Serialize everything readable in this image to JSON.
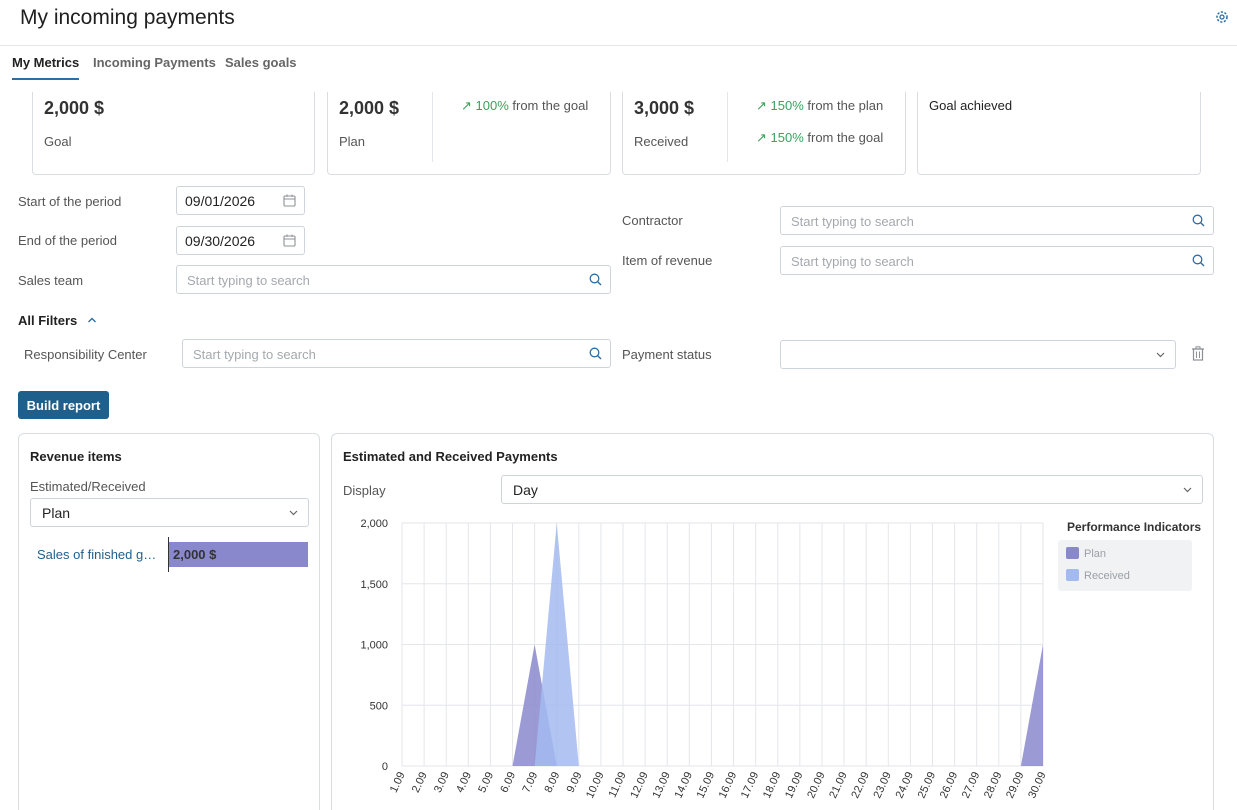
{
  "header": {
    "title": "My incoming payments"
  },
  "tabs": [
    {
      "label": "My Metrics",
      "active": true
    },
    {
      "label": "Incoming Payments",
      "active": false
    },
    {
      "label": "Sales goals",
      "active": false
    }
  ],
  "cards": {
    "goal": {
      "amount": "2,000 $",
      "label": "Goal"
    },
    "plan": {
      "amount": "2,000 $",
      "label": "Plan",
      "metric1_pct": "100%",
      "metric1_text": " from the goal"
    },
    "received": {
      "amount": "3,000 $",
      "label": "Received",
      "metric1_pct": "150%",
      "metric1_text": " from the plan",
      "metric2_pct": "150%",
      "metric2_text": " from the goal"
    },
    "status": {
      "text": "Goal achieved"
    }
  },
  "filters": {
    "start": {
      "label": "Start of the period",
      "value": "09/01/2026"
    },
    "end": {
      "label": "End of the period",
      "value": "09/30/2026"
    },
    "sales_team": {
      "label": "Sales team",
      "placeholder": "Start typing to search"
    },
    "contractor": {
      "label": "Contractor",
      "placeholder": "Start typing to search"
    },
    "item_of_revenue": {
      "label": "Item of revenue",
      "placeholder": "Start typing to search"
    },
    "all_filters_label": "All Filters",
    "responsibility_center": {
      "label": "Responsibility Center",
      "placeholder": "Start typing to search"
    },
    "payment_status": {
      "label": "Payment status",
      "value": ""
    }
  },
  "build_button": "Build report",
  "revenue_panel": {
    "title": "Revenue items",
    "select_label": "Estimated/Received",
    "select_value": "Plan",
    "rows": [
      {
        "label": "Sales of finished goods",
        "value_text": "2,000 $"
      }
    ]
  },
  "payments_panel": {
    "title": "Estimated and Received Payments",
    "display_label": "Display",
    "display_value": "Day",
    "legend_title": "Performance Indicators",
    "legend": [
      {
        "name": "Plan",
        "color": "#8a88cc"
      },
      {
        "name": "Received",
        "color": "#a3baf0"
      }
    ]
  },
  "chart_data": {
    "type": "area",
    "x": [
      "1.09",
      "2.09",
      "3.09",
      "4.09",
      "5.09",
      "6.09",
      "7.09",
      "8.09",
      "9.09",
      "10.09",
      "11.09",
      "12.09",
      "13.09",
      "14.09",
      "15.09",
      "16.09",
      "17.09",
      "18.09",
      "19.09",
      "20.09",
      "21.09",
      "22.09",
      "23.09",
      "24.09",
      "25.09",
      "26.09",
      "27.09",
      "28.09",
      "29.09",
      "30.09"
    ],
    "yticks": [
      "0",
      "500",
      "1,000",
      "1,500",
      "2,000"
    ],
    "ylim": [
      0,
      2000
    ],
    "series": [
      {
        "name": "Plan",
        "color": "#8a88cc",
        "values": [
          0,
          0,
          0,
          0,
          0,
          0,
          1000,
          0,
          0,
          0,
          0,
          0,
          0,
          0,
          0,
          0,
          0,
          0,
          0,
          0,
          0,
          0,
          0,
          0,
          0,
          0,
          0,
          0,
          0,
          1000
        ]
      },
      {
        "name": "Received",
        "color": "#a3baf0",
        "values": [
          0,
          0,
          0,
          0,
          0,
          0,
          0,
          2000,
          0,
          0,
          0,
          0,
          0,
          0,
          0,
          0,
          0,
          0,
          0,
          0,
          0,
          0,
          0,
          0,
          0,
          0,
          0,
          0,
          0,
          0
        ]
      }
    ],
    "legend_position": "right",
    "grid": true
  }
}
